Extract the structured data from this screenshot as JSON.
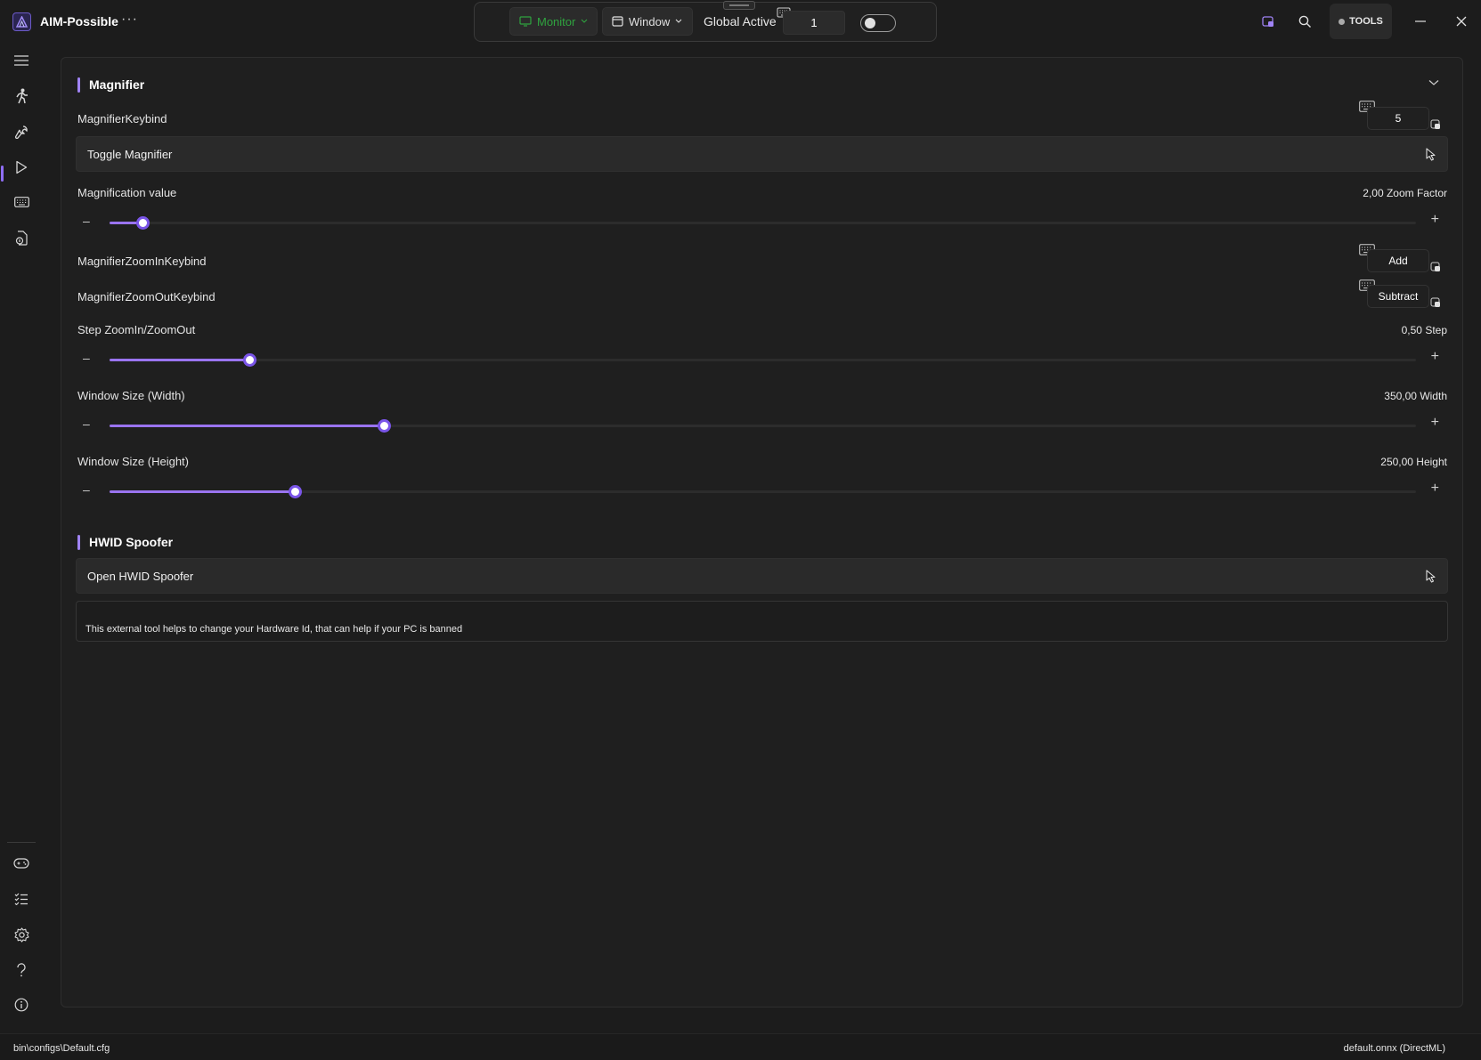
{
  "app": {
    "title": "AIM-Possible",
    "more_label": "···"
  },
  "topbar": {
    "monitor_label": "Monitor",
    "window_label": "Window",
    "global_active_label": "Global Active",
    "global_active_value": "1",
    "toggle_on": false,
    "tools_label": "TOOLS"
  },
  "colors": {
    "accent": "#9a74f0",
    "monitor_green": "#2fa33f",
    "panel_bg": "#1f1f1f"
  },
  "magnifier": {
    "title": "Magnifier",
    "keybind_label": "MagnifierKeybind",
    "keybind_value": "5",
    "toggle_label": "Toggle Magnifier",
    "magnification_label": "Magnification value",
    "magnification_value": "2,00 Zoom Factor",
    "magnification_fraction": 0.025,
    "zoom_in_label": "MagnifierZoomInKeybind",
    "zoom_in_value": "Add",
    "zoom_out_label": "MagnifierZoomOutKeybind",
    "zoom_out_value": "Subtract",
    "step_label": "Step ZoomIn/ZoomOut",
    "step_value": "0,50 Step",
    "step_fraction": 0.107,
    "width_label": "Window Size (Width)",
    "width_value": "350,00 Width",
    "width_fraction": 0.21,
    "height_label": "Window Size (Height)",
    "height_value": "250,00 Height",
    "height_fraction": 0.142
  },
  "hwid": {
    "title": "HWID Spoofer",
    "open_label": "Open HWID Spoofer",
    "description": "This external tool helps to change your Hardware Id, that can help if your PC is banned"
  },
  "status": {
    "config_path": "bin\\configs\\Default.cfg",
    "model": "default.onnx (DirectML)"
  }
}
